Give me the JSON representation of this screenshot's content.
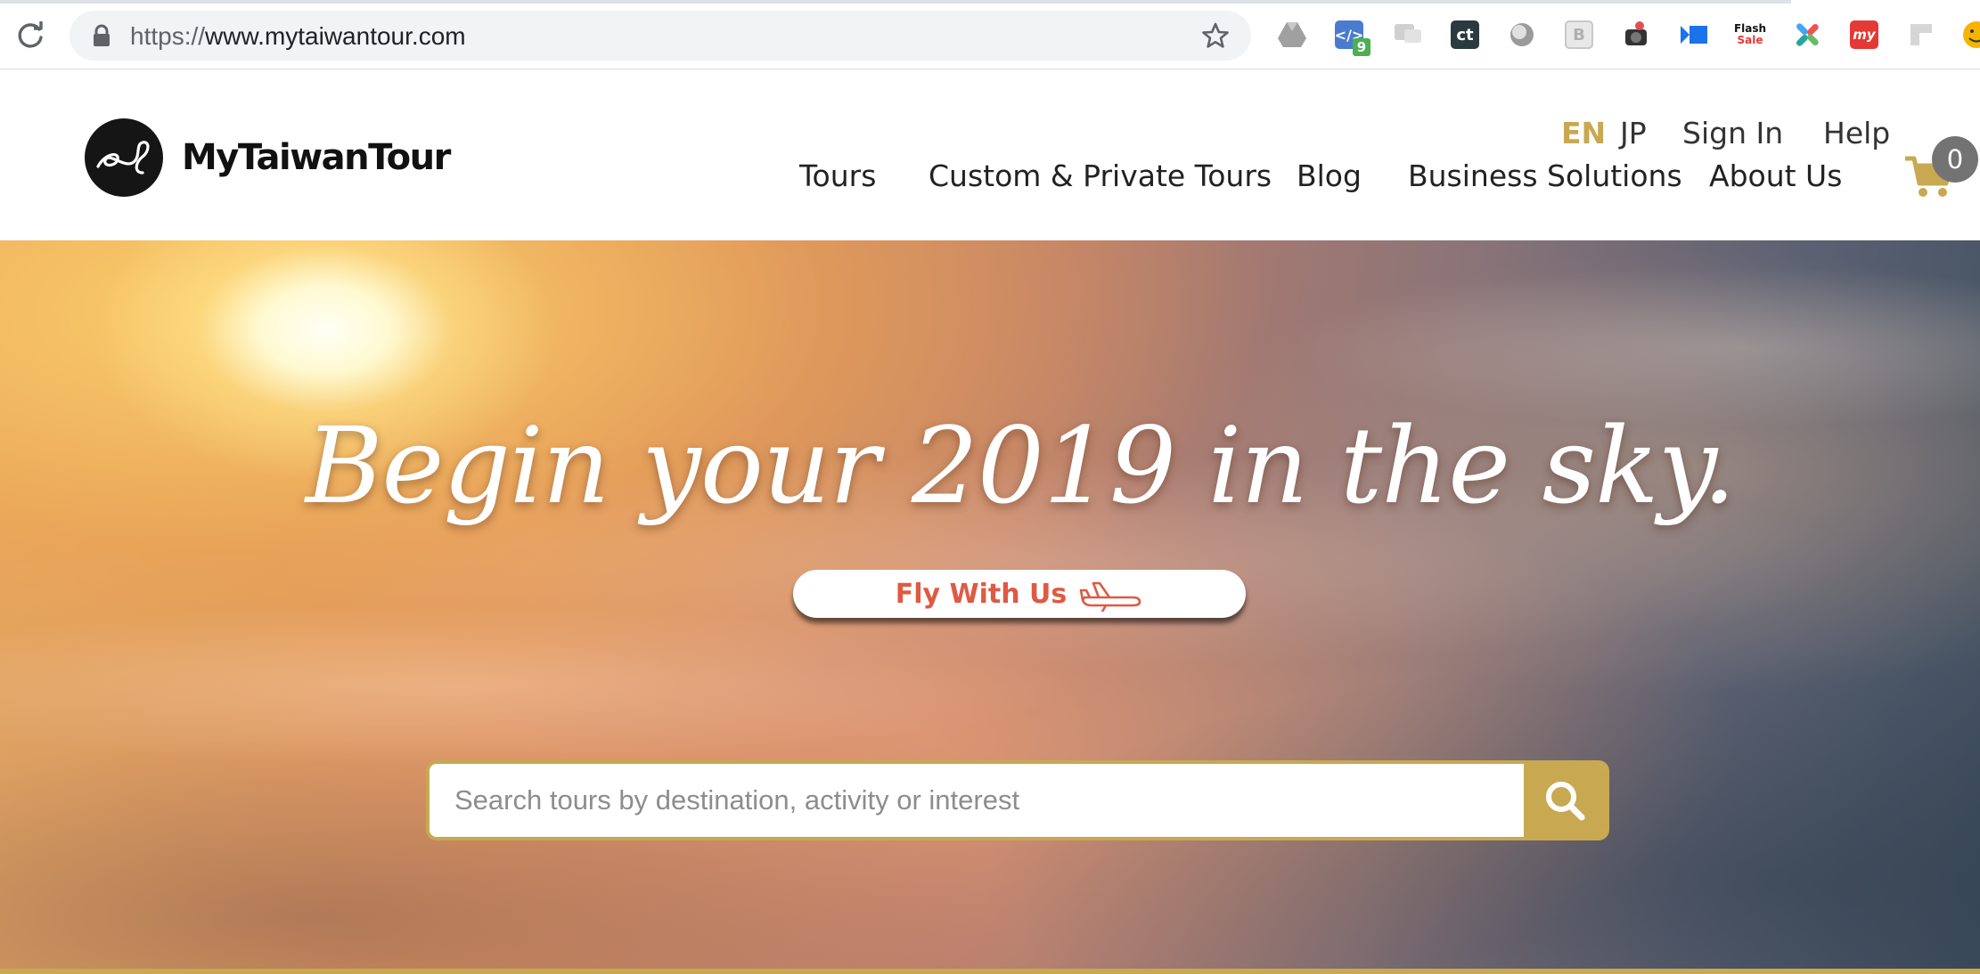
{
  "browser": {
    "url_scheme": "https://",
    "url_host": "www.mytaiwantour.com",
    "extensions": [
      {
        "name": "google-drive-icon"
      },
      {
        "name": "dev-tools-extension-icon",
        "badge": "9"
      },
      {
        "name": "chat-extension-icon"
      },
      {
        "name": "ct-extension-icon",
        "text": "ct"
      },
      {
        "name": "circle-extension-icon"
      },
      {
        "name": "b-extension-icon",
        "text": "B"
      },
      {
        "name": "camera-extension-icon"
      },
      {
        "name": "video-extension-icon"
      },
      {
        "name": "flash-sale-extension-icon",
        "line1": "Flash",
        "line2": "Sale"
      },
      {
        "name": "x-extension-icon"
      },
      {
        "name": "my-extension-icon",
        "text": "my"
      },
      {
        "name": "gray-extension-icon"
      },
      {
        "name": "emoji-extension-icon"
      }
    ]
  },
  "header": {
    "logo_text": "MyTaiwanTour",
    "lang_en": "EN",
    "lang_jp": "JP",
    "sign_in": "Sign In",
    "help": "Help",
    "nav": [
      "Tours",
      "Custom & Private Tours",
      "Blog",
      "Business Solutions",
      "About Us"
    ],
    "cart_count": "0"
  },
  "hero": {
    "headline": "Begin your 2019 in the sky.",
    "cta_label": "Fly With Us",
    "search_placeholder": "Search tours by destination, activity or interest"
  },
  "colors": {
    "gold": "#c8a951",
    "cta_red": "#de5a42"
  }
}
